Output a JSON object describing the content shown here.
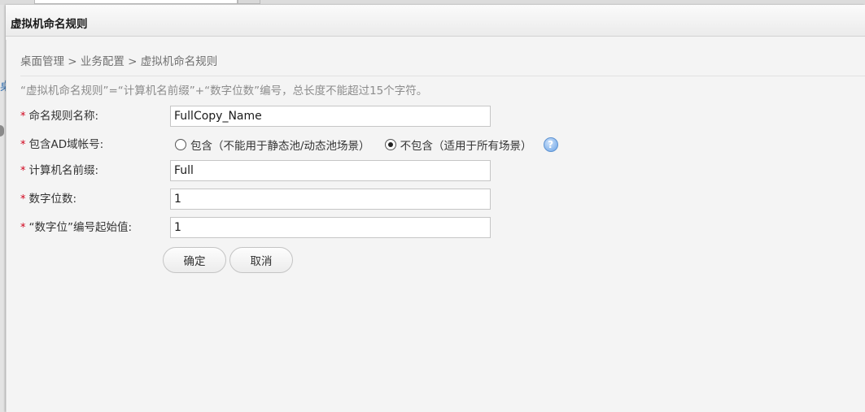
{
  "dialog": {
    "title": "虚拟机命名规则"
  },
  "breadcrumb": "桌面管理 > 业务配置 > 虚拟机命名规则",
  "hint": "“虚拟机命名规则”=“计算机名前缀”+“数字位数”编号，总长度不能超过15个字符。",
  "form": {
    "required_mark": "*",
    "rule_name": {
      "label": "命名规则名称:",
      "value": "FullCopy_Name"
    },
    "ad_account": {
      "label": "包含AD域帐号:",
      "options": [
        {
          "label": "包含（不能用于静态池/动态池场景）",
          "selected": false
        },
        {
          "label": "不包含（适用于所有场景）",
          "selected": true
        }
      ],
      "help_icon": "help-icon",
      "help_glyph": "?"
    },
    "prefix": {
      "label": "计算机名前缀:",
      "value": "Full"
    },
    "digits": {
      "label": "数字位数:",
      "value": "1"
    },
    "start_value": {
      "label": "“数字位”编号起始值:",
      "value": "1"
    }
  },
  "buttons": {
    "confirm": "确定",
    "cancel": "取消"
  },
  "background": {
    "left_glyph": "桌"
  },
  "colors": {
    "required": "#d0021b",
    "help_icon": "#6aa3e6",
    "panel": "#f4f4f4"
  }
}
